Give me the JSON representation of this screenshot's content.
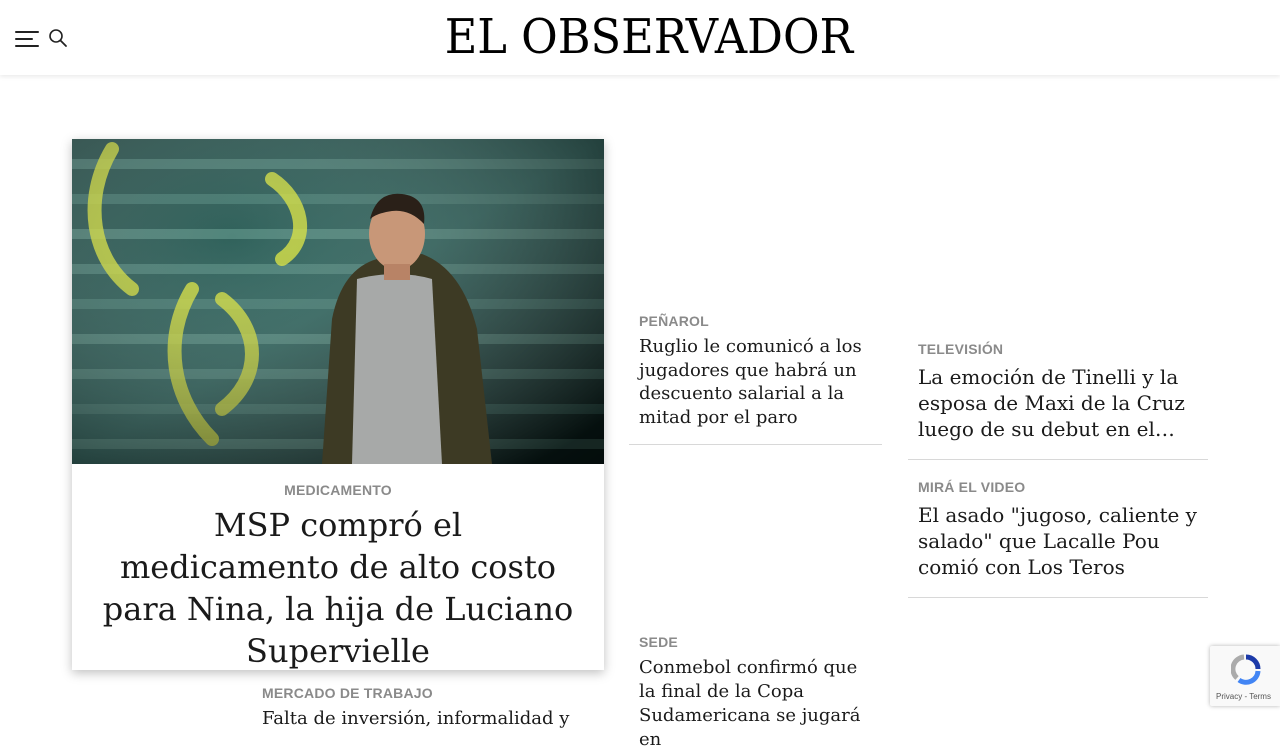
{
  "header": {
    "logo": "EL OBSERVADOR",
    "menu_icon": "hamburger-menu-icon",
    "search_icon": "search-icon"
  },
  "hero": {
    "kicker": "MEDICAMENTO",
    "title": "MSP compró el medicamento de alto costo para Nina, la hija de Luciano Supervielle",
    "image_alt": "man-leaning-on-graffiti-shutter"
  },
  "stories": [
    {
      "kicker": "PEÑAROL",
      "title": "Ruglio le comunicó a los jugadores que habrá un descuento salarial a la mitad por el paro"
    },
    {
      "kicker": "TELEVISIÓN",
      "title": "La emoción de Tinelli y la esposa de Maxi de la Cruz luego de su debut en el…"
    },
    {
      "kicker": "MIRÁ EL VIDEO",
      "title": "El asado \"jugoso, caliente y salado\" que Lacalle Pou comió con Los Teros despué…"
    },
    {
      "kicker": "SEDE",
      "title": "Conmebol confirmó que la final de la Copa Sudamericana se jugará en"
    },
    {
      "kicker": "MERCADO DE TRABAJO",
      "title": "Falta de inversión, informalidad y"
    }
  ],
  "recaptcha": {
    "links": "Privacy - Terms"
  },
  "colors": {
    "kicker": "#8a8a8a",
    "text": "#1a1a1a",
    "divider": "#d8d8d8"
  }
}
